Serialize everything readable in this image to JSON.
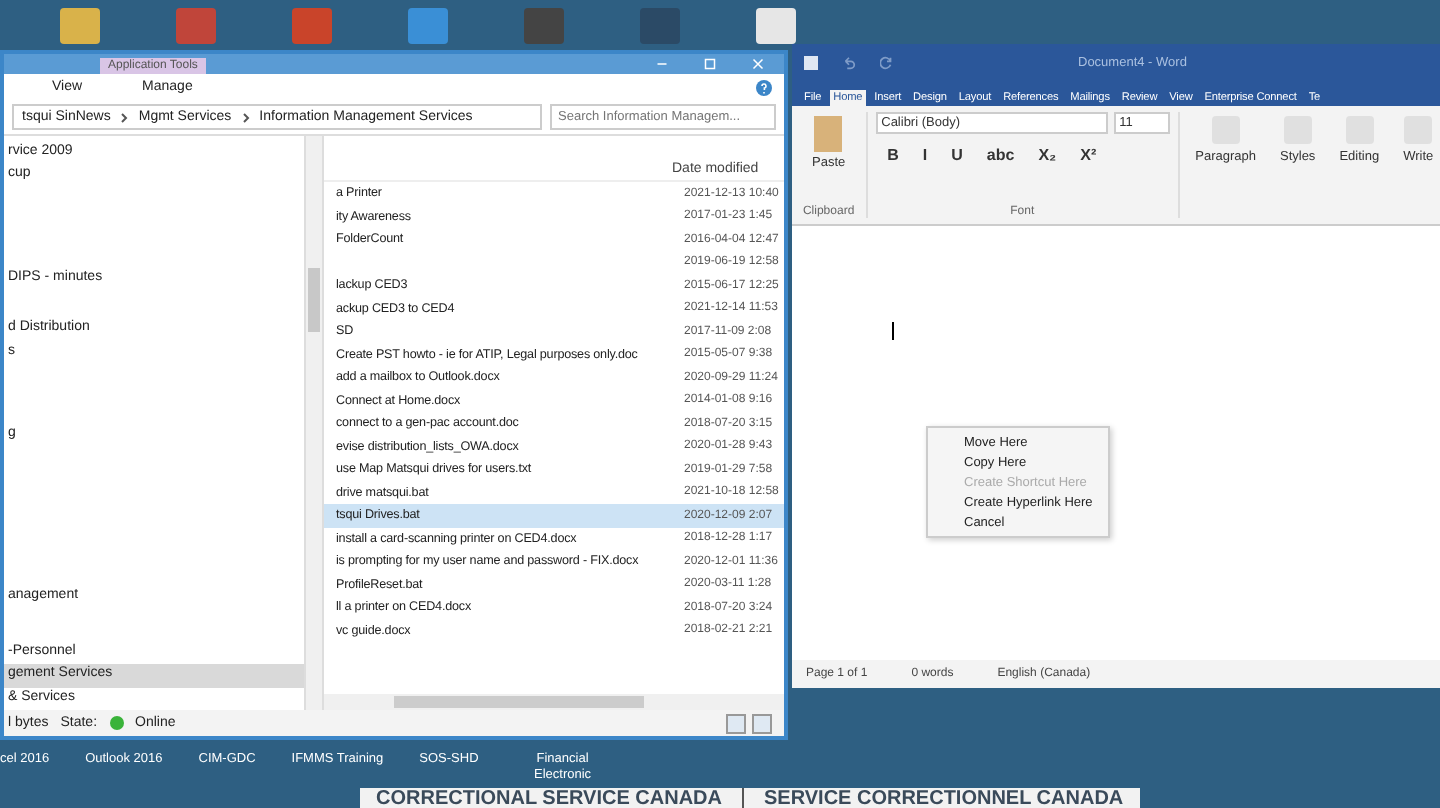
{
  "desktop_icons_top": [
    {
      "kind": "folder"
    },
    {
      "kind": "people"
    },
    {
      "kind": "slides"
    },
    {
      "kind": "globe"
    },
    {
      "kind": "legis"
    },
    {
      "kind": "siu"
    },
    {
      "kind": "doc"
    }
  ],
  "explorer": {
    "contextual_tab": "Application Tools",
    "tabs": [
      {
        "label": "View",
        "selected": false
      },
      {
        "label": "Manage",
        "selected": false
      }
    ],
    "address": [
      "tsqui SinNews",
      "Mgmt Services",
      "Information Management Services"
    ],
    "search": {
      "placeholder": "Search Information Managem..."
    },
    "nav_items": [
      {
        "label": "rvice 2009",
        "selected": false
      },
      {
        "label": "cup",
        "selected": false
      },
      {
        "label": "DIPS - minutes",
        "selected": false
      },
      {
        "label": "d Distribution",
        "selected": false
      },
      {
        "label": "s",
        "selected": false
      },
      {
        "label": "g",
        "selected": false
      },
      {
        "label": "anagement",
        "selected": false
      },
      {
        "label": "-Personnel",
        "selected": false
      },
      {
        "label": "gement Services",
        "selected": true
      },
      {
        "label": "& Services",
        "selected": false
      }
    ],
    "column": "Date modified",
    "rows": [
      {
        "name": "a Printer",
        "date": "2021-12-13 10:40",
        "selected": false
      },
      {
        "name": "ity Awareness",
        "date": "2017-01-23 1:45",
        "selected": false
      },
      {
        "name": "FolderCount",
        "date": "2016-04-04 12:47",
        "selected": false
      },
      {
        "name": "",
        "date": "2019-06-19 12:58",
        "selected": false
      },
      {
        "name": "lackup CED3",
        "date": "2015-06-17 12:25",
        "selected": false
      },
      {
        "name": "ackup CED3 to CED4",
        "date": "2021-12-14 11:53",
        "selected": false
      },
      {
        "name": "SD",
        "date": "2017-11-09 2:08",
        "selected": false
      },
      {
        "name": "Create PST howto - ie for ATIP, Legal purposes only.doc",
        "date": "2015-05-07 9:38",
        "selected": false
      },
      {
        "name": "add a mailbox to Outlook.docx",
        "date": "2020-09-29 11:24",
        "selected": false
      },
      {
        "name": "Connect at Home.docx",
        "date": "2014-01-08 9:16",
        "selected": false
      },
      {
        "name": "connect to a gen-pac account.doc",
        "date": "2018-07-20 3:15",
        "selected": false
      },
      {
        "name": "evise distribution_lists_OWA.docx",
        "date": "2020-01-28 9:43",
        "selected": false
      },
      {
        "name": "use Map Matsqui drives for users.txt",
        "date": "2019-01-29 7:58",
        "selected": false
      },
      {
        "name": "drive matsqui.bat",
        "date": "2021-10-18 12:58",
        "selected": false
      },
      {
        "name": "tsqui Drives.bat",
        "date": "2020-12-09 2:07",
        "selected": true
      },
      {
        "name": "install a card-scanning printer on CED4.docx",
        "date": "2018-12-28 1:17",
        "selected": false
      },
      {
        "name": "is prompting for my user name and password - FIX.docx",
        "date": "2020-12-01 11:36",
        "selected": false
      },
      {
        "name": "ProfileReset.bat",
        "date": "2020-03-11 1:28",
        "selected": false
      },
      {
        "name": "ll a printer on CED4.docx",
        "date": "2018-07-20 3:24",
        "selected": false
      },
      {
        "name": "vc guide.docx",
        "date": "2018-02-21 2:21",
        "selected": false
      }
    ],
    "status": {
      "size": "l bytes",
      "state_label": "State:",
      "state": "Online"
    }
  },
  "word": {
    "title": "Document4 - Word",
    "tabs": [
      {
        "label": "File",
        "selected": false
      },
      {
        "label": "Home",
        "selected": true
      },
      {
        "label": "Insert",
        "selected": false
      },
      {
        "label": "Design",
        "selected": false
      },
      {
        "label": "Layout",
        "selected": false
      },
      {
        "label": "References",
        "selected": false
      },
      {
        "label": "Mailings",
        "selected": false
      },
      {
        "label": "Review",
        "selected": false
      },
      {
        "label": "View",
        "selected": false
      },
      {
        "label": "Enterprise Connect",
        "selected": false
      },
      {
        "label": "Te",
        "selected": false
      }
    ],
    "paste": "Paste",
    "clipboard": "Clipboard",
    "font_name": "Calibri (Body)",
    "font_size": "11",
    "font_group": "Font",
    "format_buttons": [
      "B",
      "I",
      "U",
      "abc",
      "X₂",
      "X²"
    ],
    "groups": [
      "Paragraph",
      "Styles",
      "Editing",
      "Write"
    ],
    "context_menu": [
      {
        "label": "Move Here",
        "disabled": false
      },
      {
        "label": "Copy Here",
        "disabled": false
      },
      {
        "label": "Create Shortcut Here",
        "disabled": true
      },
      {
        "label": "Create Hyperlink Here",
        "disabled": false
      },
      {
        "label": "Cancel",
        "disabled": false
      }
    ],
    "status": [
      "Page 1 of 1",
      "0 words",
      "English (Canada)"
    ]
  },
  "desktop_labels": [
    "cel 2016",
    "Outlook 2016",
    "CIM-GDC",
    "IFMMS Training",
    "SOS-SHD",
    "Financial Electronic"
  ],
  "banner": [
    "CORRECTIONAL SERVICE CANADA",
    "SERVICE CORRECTIONNEL CANADA"
  ]
}
